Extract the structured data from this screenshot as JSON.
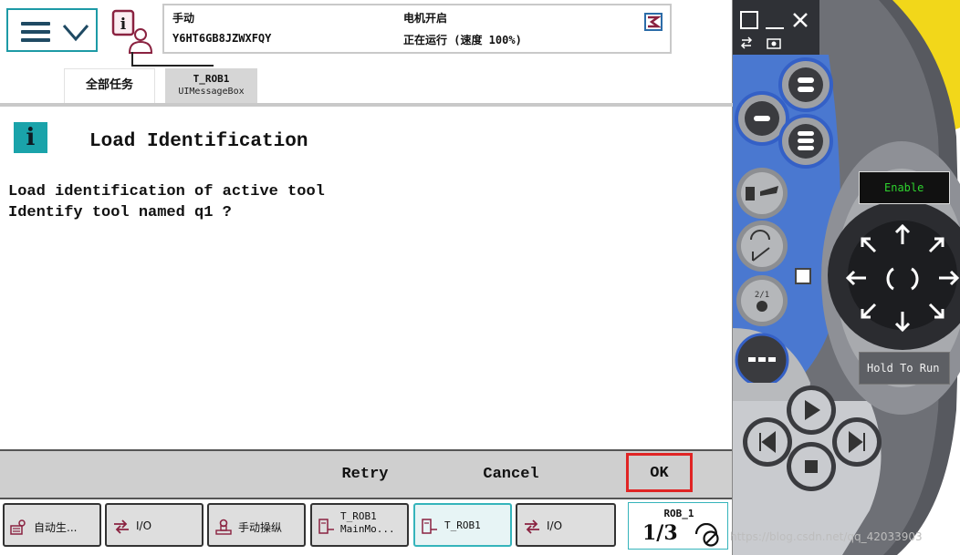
{
  "status_bar": {
    "mode": "手动",
    "controller_name": "Y6HT6GB8JZWXFQY",
    "motor_state": "电机开启",
    "run_state": "正在运行 (速度 100%)"
  },
  "tabs": [
    {
      "label": "全部任务"
    },
    {
      "label": "T_ROB1",
      "sublabel": "UIMessageBox"
    }
  ],
  "message": {
    "title": "Load Identification",
    "lines": [
      "Load identification of active tool",
      "Identify tool named q1 ?"
    ]
  },
  "dialog_buttons": {
    "retry": "Retry",
    "cancel": "Cancel",
    "ok": "OK",
    "ok_highlight_color": "#e02424"
  },
  "taskbar": [
    {
      "label": "自动生...",
      "icon": "auto-production-icon"
    },
    {
      "label": "I/O",
      "icon": "io-icon"
    },
    {
      "label": "手动操纵",
      "icon": "jogging-icon"
    },
    {
      "label": "T_ROB1",
      "sublabel": "MainMo...",
      "icon": "program-editor-icon"
    },
    {
      "label": "T_ROB1",
      "icon": "program-editor-icon",
      "active": true
    },
    {
      "label": "I/O",
      "icon": "io-icon"
    }
  ],
  "quickset": {
    "robot": "ROB_1",
    "fraction": "1/3"
  },
  "controller": {
    "enable_label": "Enable",
    "hold_to_run_label": "Hold To Run"
  },
  "watermark": "https://blog.csdn.net/qq_42033903",
  "colors": {
    "accent": "#1aa3aa",
    "jog_ring": "#3b6fd0",
    "yellow_body": "#f2d71a",
    "red_stop": "#d62222"
  }
}
